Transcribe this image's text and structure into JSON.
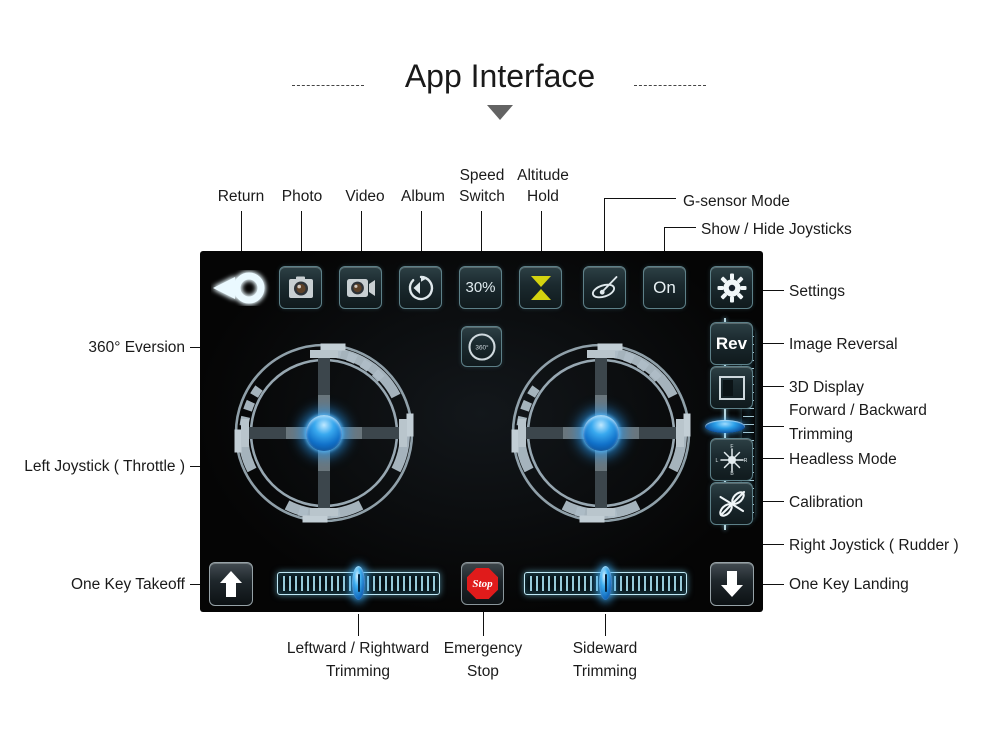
{
  "page": {
    "title": "App Interface",
    "background": "#ffffff",
    "panel_bg": "#050505",
    "accent_blue": "#2a9fe8",
    "accent_yellow": "#d8d412",
    "accent_red": "#e01b1b"
  },
  "toolbar_top": {
    "return": {
      "label": "Return",
      "icon": "return-play-icon"
    },
    "photo": {
      "label": "Photo",
      "icon": "camera-icon"
    },
    "video": {
      "label": "Video",
      "icon": "camcorder-icon"
    },
    "album": {
      "label": "Album",
      "icon": "album-refresh-icon"
    },
    "speed_switch": {
      "label": "Speed Switch",
      "label_line1": "Speed",
      "label_line2": "Switch",
      "value": "30%"
    },
    "altitude_hold": {
      "label": "Altitude Hold",
      "label_line1": "Altitude",
      "label_line2": "Hold",
      "icon": "hourglass-icon"
    },
    "gsensor": {
      "label": "G-sensor Mode",
      "icon": "gyroscope-icon"
    },
    "show_hide_joysticks": {
      "label": "Show / Hide Joysticks",
      "value": "On"
    },
    "settings": {
      "label": "Settings",
      "icon": "gear-icon"
    }
  },
  "right_column": {
    "image_reversal": {
      "label": "Image Reversal",
      "value": "Rev"
    },
    "three_d_display": {
      "label": "3D Display",
      "icon": "3d-display-icon"
    },
    "forward_backward_trimming": {
      "label_line1": "Forward / Backward",
      "label_line2": "Trimming",
      "label": "Forward / Backward Trimming"
    },
    "headless_mode": {
      "label": "Headless Mode",
      "icon": "compass-icon",
      "compass_letters": {
        "front": "F",
        "back": "B",
        "left": "L",
        "right": "R"
      }
    },
    "calibration": {
      "label": "Calibration",
      "icon": "drone-propeller-icon"
    },
    "right_joystick": {
      "label": "Right Joystick ( Rudder )"
    }
  },
  "left_column": {
    "eversion": {
      "label": "360° Eversion",
      "button_text": "360°",
      "icon": "flip-360-icon"
    },
    "left_joystick": {
      "label": "Left Joystick ( Throttle )"
    }
  },
  "bottom_bar": {
    "one_key_takeoff": {
      "label": "One Key Takeoff",
      "icon": "arrow-up-icon"
    },
    "leftward_rightward_trimming": {
      "label_line1": "Leftward / Rightward",
      "label_line2": "Trimming",
      "label": "Leftward / Rightward Trimming"
    },
    "emergency_stop": {
      "label_line1": "Emergency",
      "label_line2": "Stop",
      "label": "Emergency Stop",
      "button_text": "Stop"
    },
    "sideward_trimming": {
      "label_line1": "Sideward",
      "label_line2": "Trimming",
      "label": "Sideward Trimming"
    },
    "one_key_landing": {
      "label": "One Key Landing",
      "icon": "arrow-down-icon"
    }
  }
}
